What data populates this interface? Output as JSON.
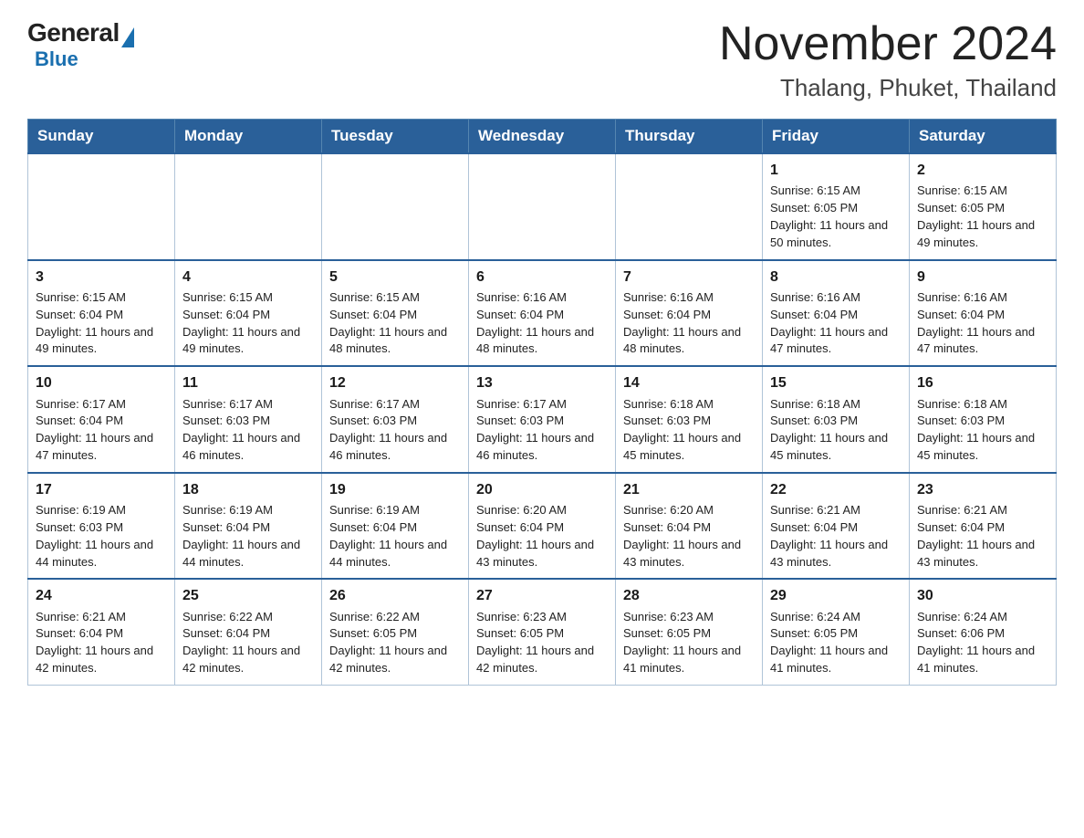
{
  "header": {
    "logo_general": "General",
    "logo_blue": "Blue",
    "title": "November 2024",
    "subtitle": "Thalang, Phuket, Thailand"
  },
  "calendar": {
    "days_of_week": [
      "Sunday",
      "Monday",
      "Tuesday",
      "Wednesday",
      "Thursday",
      "Friday",
      "Saturday"
    ],
    "weeks": [
      [
        {
          "day": "",
          "info": ""
        },
        {
          "day": "",
          "info": ""
        },
        {
          "day": "",
          "info": ""
        },
        {
          "day": "",
          "info": ""
        },
        {
          "day": "",
          "info": ""
        },
        {
          "day": "1",
          "info": "Sunrise: 6:15 AM\nSunset: 6:05 PM\nDaylight: 11 hours and 50 minutes."
        },
        {
          "day": "2",
          "info": "Sunrise: 6:15 AM\nSunset: 6:05 PM\nDaylight: 11 hours and 49 minutes."
        }
      ],
      [
        {
          "day": "3",
          "info": "Sunrise: 6:15 AM\nSunset: 6:04 PM\nDaylight: 11 hours and 49 minutes."
        },
        {
          "day": "4",
          "info": "Sunrise: 6:15 AM\nSunset: 6:04 PM\nDaylight: 11 hours and 49 minutes."
        },
        {
          "day": "5",
          "info": "Sunrise: 6:15 AM\nSunset: 6:04 PM\nDaylight: 11 hours and 48 minutes."
        },
        {
          "day": "6",
          "info": "Sunrise: 6:16 AM\nSunset: 6:04 PM\nDaylight: 11 hours and 48 minutes."
        },
        {
          "day": "7",
          "info": "Sunrise: 6:16 AM\nSunset: 6:04 PM\nDaylight: 11 hours and 48 minutes."
        },
        {
          "day": "8",
          "info": "Sunrise: 6:16 AM\nSunset: 6:04 PM\nDaylight: 11 hours and 47 minutes."
        },
        {
          "day": "9",
          "info": "Sunrise: 6:16 AM\nSunset: 6:04 PM\nDaylight: 11 hours and 47 minutes."
        }
      ],
      [
        {
          "day": "10",
          "info": "Sunrise: 6:17 AM\nSunset: 6:04 PM\nDaylight: 11 hours and 47 minutes."
        },
        {
          "day": "11",
          "info": "Sunrise: 6:17 AM\nSunset: 6:03 PM\nDaylight: 11 hours and 46 minutes."
        },
        {
          "day": "12",
          "info": "Sunrise: 6:17 AM\nSunset: 6:03 PM\nDaylight: 11 hours and 46 minutes."
        },
        {
          "day": "13",
          "info": "Sunrise: 6:17 AM\nSunset: 6:03 PM\nDaylight: 11 hours and 46 minutes."
        },
        {
          "day": "14",
          "info": "Sunrise: 6:18 AM\nSunset: 6:03 PM\nDaylight: 11 hours and 45 minutes."
        },
        {
          "day": "15",
          "info": "Sunrise: 6:18 AM\nSunset: 6:03 PM\nDaylight: 11 hours and 45 minutes."
        },
        {
          "day": "16",
          "info": "Sunrise: 6:18 AM\nSunset: 6:03 PM\nDaylight: 11 hours and 45 minutes."
        }
      ],
      [
        {
          "day": "17",
          "info": "Sunrise: 6:19 AM\nSunset: 6:03 PM\nDaylight: 11 hours and 44 minutes."
        },
        {
          "day": "18",
          "info": "Sunrise: 6:19 AM\nSunset: 6:04 PM\nDaylight: 11 hours and 44 minutes."
        },
        {
          "day": "19",
          "info": "Sunrise: 6:19 AM\nSunset: 6:04 PM\nDaylight: 11 hours and 44 minutes."
        },
        {
          "day": "20",
          "info": "Sunrise: 6:20 AM\nSunset: 6:04 PM\nDaylight: 11 hours and 43 minutes."
        },
        {
          "day": "21",
          "info": "Sunrise: 6:20 AM\nSunset: 6:04 PM\nDaylight: 11 hours and 43 minutes."
        },
        {
          "day": "22",
          "info": "Sunrise: 6:21 AM\nSunset: 6:04 PM\nDaylight: 11 hours and 43 minutes."
        },
        {
          "day": "23",
          "info": "Sunrise: 6:21 AM\nSunset: 6:04 PM\nDaylight: 11 hours and 43 minutes."
        }
      ],
      [
        {
          "day": "24",
          "info": "Sunrise: 6:21 AM\nSunset: 6:04 PM\nDaylight: 11 hours and 42 minutes."
        },
        {
          "day": "25",
          "info": "Sunrise: 6:22 AM\nSunset: 6:04 PM\nDaylight: 11 hours and 42 minutes."
        },
        {
          "day": "26",
          "info": "Sunrise: 6:22 AM\nSunset: 6:05 PM\nDaylight: 11 hours and 42 minutes."
        },
        {
          "day": "27",
          "info": "Sunrise: 6:23 AM\nSunset: 6:05 PM\nDaylight: 11 hours and 42 minutes."
        },
        {
          "day": "28",
          "info": "Sunrise: 6:23 AM\nSunset: 6:05 PM\nDaylight: 11 hours and 41 minutes."
        },
        {
          "day": "29",
          "info": "Sunrise: 6:24 AM\nSunset: 6:05 PM\nDaylight: 11 hours and 41 minutes."
        },
        {
          "day": "30",
          "info": "Sunrise: 6:24 AM\nSunset: 6:06 PM\nDaylight: 11 hours and 41 minutes."
        }
      ]
    ]
  }
}
